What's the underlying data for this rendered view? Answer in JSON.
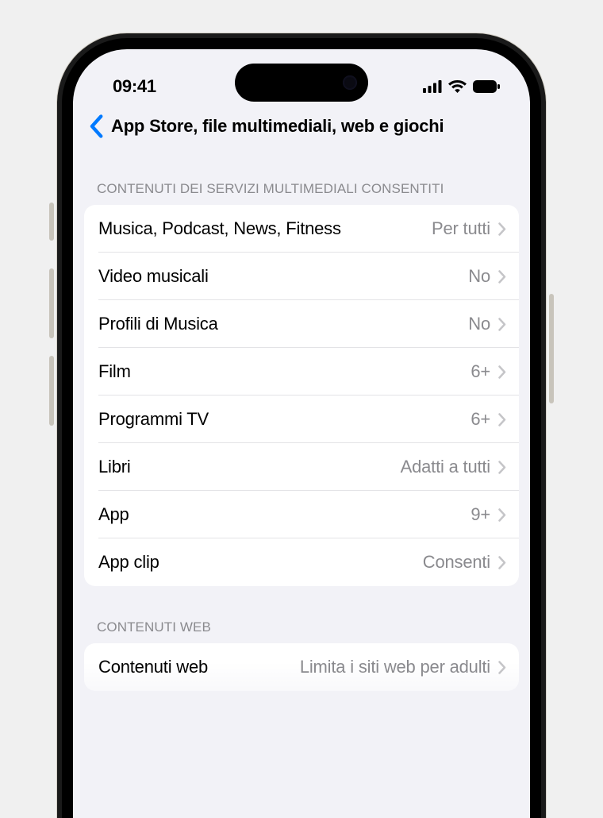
{
  "statusBar": {
    "time": "09:41"
  },
  "nav": {
    "title": "App Store, file multimediali, web e giochi"
  },
  "sections": [
    {
      "header": "CONTENUTI DEI SERVIZI MULTIMEDIALI CONSENTITI",
      "rows": [
        {
          "label": "Musica, Podcast, News, Fitness",
          "value": "Per tutti"
        },
        {
          "label": "Video musicali",
          "value": "No"
        },
        {
          "label": "Profili di Musica",
          "value": "No"
        },
        {
          "label": "Film",
          "value": "6+"
        },
        {
          "label": "Programmi TV",
          "value": "6+"
        },
        {
          "label": "Libri",
          "value": "Adatti a tutti"
        },
        {
          "label": "App",
          "value": "9+"
        },
        {
          "label": "App clip",
          "value": "Consenti"
        }
      ]
    },
    {
      "header": "CONTENUTI WEB",
      "rows": [
        {
          "label": "Contenuti web",
          "value": "Limita i siti web per adulti"
        }
      ]
    }
  ]
}
